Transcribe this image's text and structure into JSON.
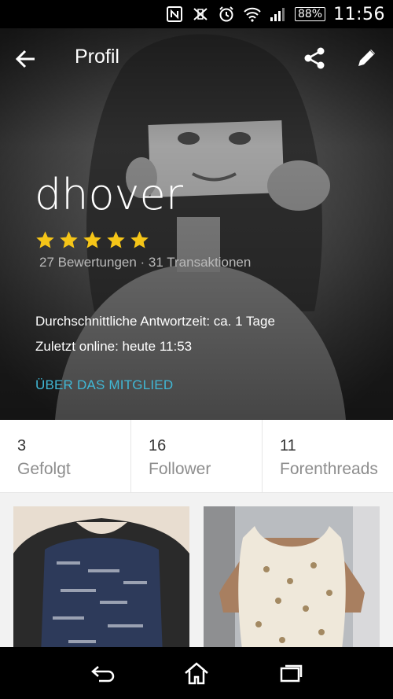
{
  "status_bar": {
    "battery": "88%",
    "time": "11:56",
    "icons": [
      "nfc-icon",
      "vibrate-icon",
      "alarm-icon",
      "wifi-icon",
      "signal-icon",
      "battery-icon"
    ]
  },
  "toolbar": {
    "title": "Profil",
    "back_icon": "arrow-back-icon",
    "share_icon": "share-icon",
    "edit_icon": "pencil-icon"
  },
  "profile": {
    "username": "dhover",
    "rating_stars": 5,
    "reviews_text": "27 Bewertungen · 31 Transaktionen",
    "response_time": "Durchschnittliche Antwortzeit:  ca. 1 Tage",
    "last_online": "Zuletzt online: heute 11:53",
    "about_link": "ÜBER DAS MITGLIED",
    "star_color": "#f5c518",
    "link_color": "#40b8d6"
  },
  "stats": [
    {
      "count": "3",
      "label": "Gefolgt"
    },
    {
      "count": "16",
      "label": "Follower"
    },
    {
      "count": "11",
      "label": "Forenthreads"
    }
  ],
  "navbar": {
    "icons": [
      "back-nav-icon",
      "home-nav-icon",
      "recent-apps-icon"
    ]
  }
}
